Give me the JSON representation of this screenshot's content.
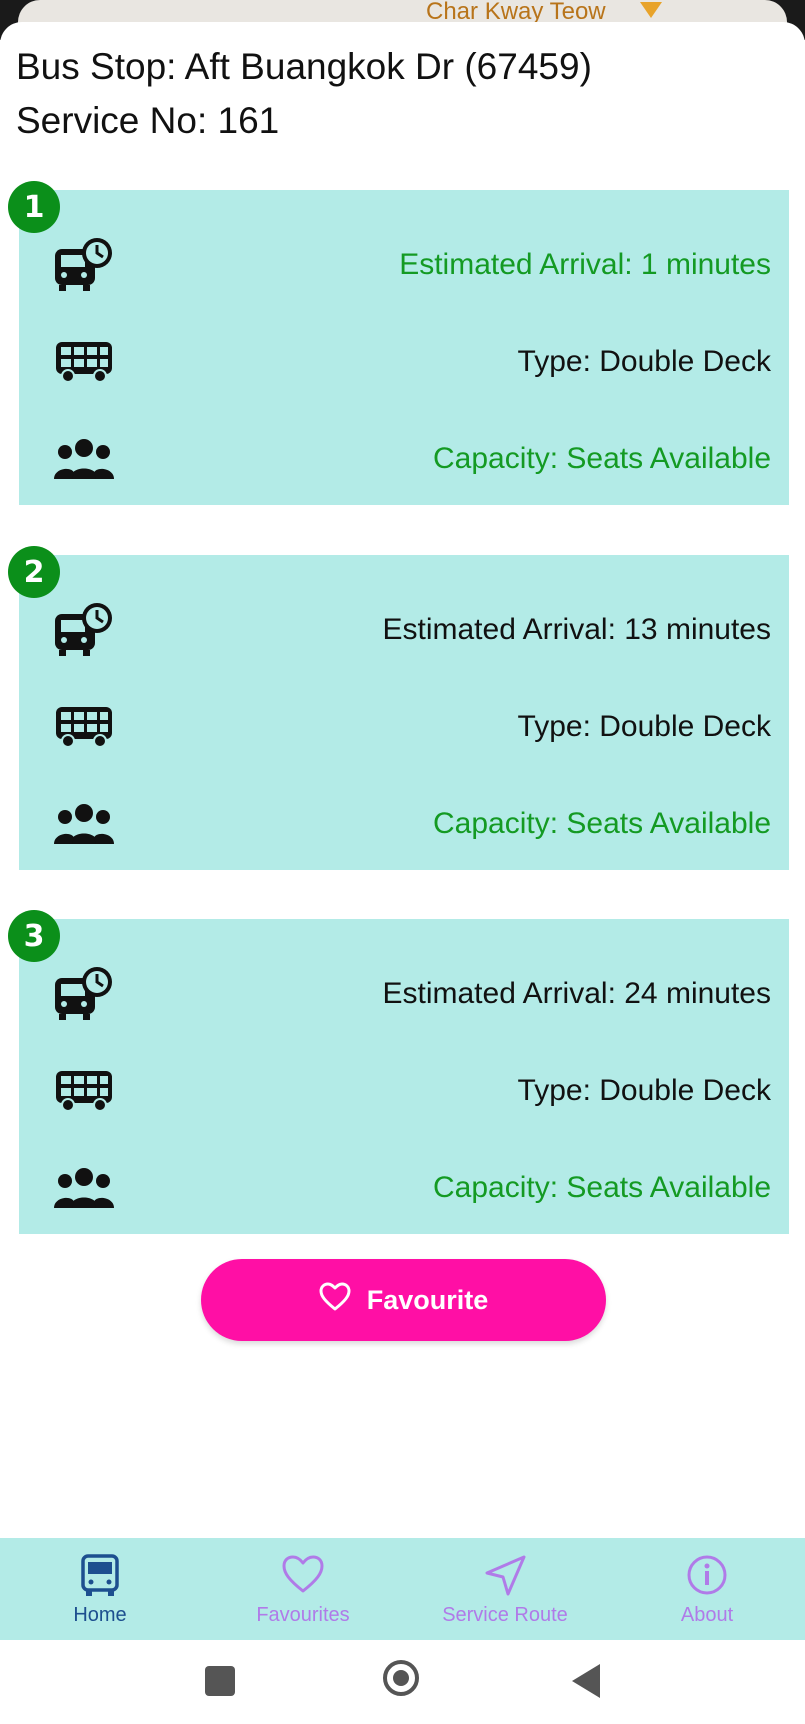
{
  "map": {
    "label": "Char Kway Teow"
  },
  "header": {
    "bus_stop": "Bus Stop: Aft Buangkok Dr (67459)",
    "service": "Service No: 161"
  },
  "arrivals": [
    {
      "badge": "1",
      "estimated": "Estimated Arrival: 1 minutes",
      "estimated_color": "green",
      "type": "Type: Double Deck",
      "capacity": "Capacity: Seats Available"
    },
    {
      "badge": "2",
      "estimated": "Estimated Arrival: 13 minutes",
      "estimated_color": "black",
      "type": "Type: Double Deck",
      "capacity": "Capacity: Seats Available"
    },
    {
      "badge": "3",
      "estimated": "Estimated Arrival: 24 minutes",
      "estimated_color": "black",
      "type": "Type: Double Deck",
      "capacity": "Capacity: Seats Available"
    }
  ],
  "favourite_button": {
    "label": "Favourite",
    "icon": "heart-outline-icon"
  },
  "bottom_nav": {
    "items": [
      {
        "label": "Home",
        "icon": "bus-icon",
        "active": true
      },
      {
        "label": "Favourites",
        "icon": "heart-outline-icon",
        "active": false
      },
      {
        "label": "Service Route",
        "icon": "navigation-arrow-icon",
        "active": false
      },
      {
        "label": "About",
        "icon": "info-icon",
        "active": false
      }
    ]
  },
  "colors": {
    "card_bg": "#b3ebe7",
    "badge_green": "#0b8f1a",
    "status_green": "#149a23",
    "favourite_pink": "#ff0fa5",
    "nav_active": "#1d4f8f",
    "nav_inactive": "#b07be8"
  }
}
